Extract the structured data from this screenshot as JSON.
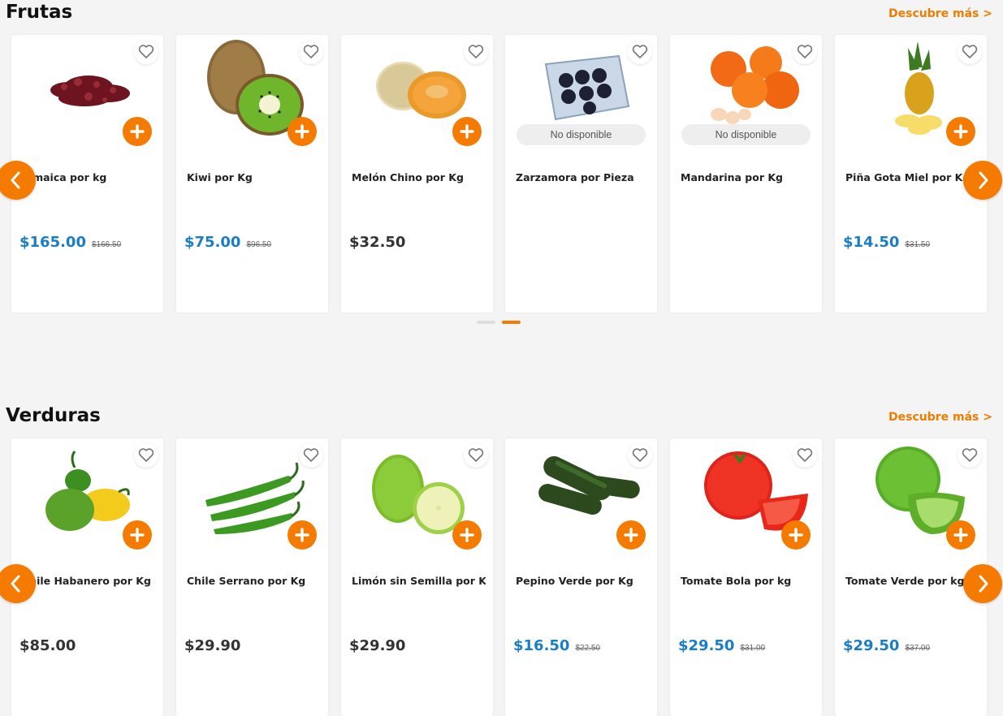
{
  "sections": [
    {
      "title": "Frutas",
      "more": "Descubre más >",
      "products": [
        {
          "name": "Jamaica por kg",
          "price": "$165.00",
          "old": "$166.50",
          "sale": true,
          "available": true,
          "image": "hibiscus-image"
        },
        {
          "name": "Kiwi por Kg",
          "price": "$75.00",
          "old": "$96.50",
          "sale": true,
          "available": true,
          "image": "kiwi-image"
        },
        {
          "name": "Melón Chino por Kg",
          "price": "$32.50",
          "old": "",
          "sale": false,
          "available": true,
          "image": "melon-image"
        },
        {
          "name": "Zarzamora por Pieza",
          "price": "",
          "old": "",
          "sale": false,
          "available": false,
          "image": "blackberry-image"
        },
        {
          "name": "Mandarina por Kg",
          "price": "",
          "old": "",
          "sale": false,
          "available": false,
          "image": "tangerine-image"
        },
        {
          "name": "Piña Gota Miel por Kg",
          "price": "$14.50",
          "old": "$31.50",
          "sale": true,
          "available": true,
          "image": "pineapple-image"
        }
      ]
    },
    {
      "title": "Verduras",
      "more": "Descubre más >",
      "products": [
        {
          "name": "Chile Habanero por Kg",
          "price": "$85.00",
          "old": "",
          "sale": false,
          "available": true,
          "image": "habanero-image"
        },
        {
          "name": "Chile Serrano por Kg",
          "price": "$29.90",
          "old": "",
          "sale": false,
          "available": true,
          "image": "serrano-image"
        },
        {
          "name": "Limón sin Semilla por Kg",
          "price": "$29.90",
          "old": "",
          "sale": false,
          "available": true,
          "image": "lime-image"
        },
        {
          "name": "Pepino Verde por Kg",
          "price": "$16.50",
          "old": "$22.50",
          "sale": true,
          "available": true,
          "image": "cucumber-image"
        },
        {
          "name": "Tomate Bola por kg",
          "price": "$29.50",
          "old": "$31.00",
          "sale": true,
          "available": true,
          "image": "tomato-image"
        },
        {
          "name": "Tomate Verde por kg",
          "price": "$29.50",
          "old": "$37.00",
          "sale": true,
          "available": true,
          "image": "green-tomato-image"
        }
      ]
    }
  ],
  "unavailable_label": "No disponible",
  "colors": {
    "accent": "#f47b00",
    "link": "#ef7d00",
    "sale_price": "#1a7ec5",
    "regular_price": "#333333"
  },
  "icons": [
    "heart-icon",
    "plus-icon",
    "chevron-left-icon",
    "chevron-right-icon"
  ]
}
